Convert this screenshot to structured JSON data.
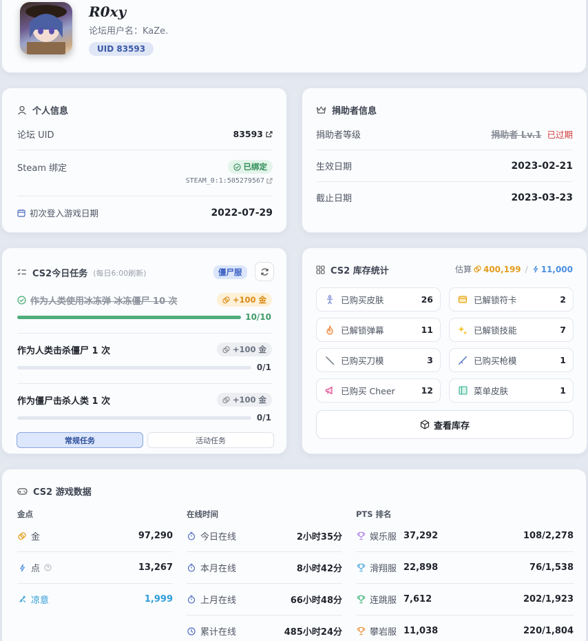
{
  "profile": {
    "name": "R0xy",
    "forum_username": "论坛用户名：KaZe.",
    "uid_badge": "UID 83593"
  },
  "personal": {
    "title": "个人信息",
    "forum_uid_label": "论坛 UID",
    "forum_uid": "83593",
    "steam_label": "Steam 绑定",
    "steam_status": "已绑定",
    "steam_id": "STEAM_0:1:505279567",
    "first_login_label": "初次登入游戏日期",
    "first_login": "2022-07-29"
  },
  "donor": {
    "title": "捐助者信息",
    "level_label": "捐助者等级",
    "level": "捐助者 Lv.1",
    "expired": "已过期",
    "start_label": "生效日期",
    "start": "2023-02-21",
    "end_label": "截止日期",
    "end": "2023-03-23"
  },
  "tasks": {
    "title": "CS2今日任务",
    "refresh_note": "(每日6:00刷新)",
    "server_badge": "僵尸服",
    "items": [
      {
        "name": "作为人类使用冰冻弹 冰冻僵尸 10 次",
        "reward": "+100 金",
        "progress": "10/10",
        "fraction": 1.0,
        "done": true
      },
      {
        "name": "作为人类击杀僵尸 1 次",
        "reward": "+100 金",
        "progress": "0/1",
        "fraction": 0.0,
        "done": false
      },
      {
        "name": "作为僵尸击杀人类 1 次",
        "reward": "+100 金",
        "progress": "0/1",
        "fraction": 0.0,
        "done": false
      }
    ],
    "tab_regular": "常规任务",
    "tab_event": "活动任务"
  },
  "inventory": {
    "title": "CS2 库存统计",
    "estimate_label": "估算",
    "estimate_gold": "400,199",
    "slash": "/",
    "estimate_points": "11,000",
    "stats": [
      {
        "label": "已购买皮肤",
        "value": "26",
        "icon": "person-icon"
      },
      {
        "label": "已解锁符卡",
        "value": "2",
        "icon": "card-icon"
      },
      {
        "label": "已解锁弹幕",
        "value": "11",
        "icon": "flame-icon"
      },
      {
        "label": "已解锁技能",
        "value": "7",
        "icon": "sparkle-icon"
      },
      {
        "label": "已购买刀模",
        "value": "3",
        "icon": "knife-icon"
      },
      {
        "label": "已购买枪模",
        "value": "1",
        "icon": "gun-icon"
      },
      {
        "label": "已购买 Cheer",
        "value": "12",
        "icon": "megaphone-icon"
      },
      {
        "label": "菜单皮肤",
        "value": "1",
        "icon": "panel-icon"
      }
    ],
    "view_button": "查看库存"
  },
  "game": {
    "title": "CS2 游戏数据",
    "currency_header": "金点",
    "currency": [
      {
        "label": "金",
        "value": "97,290"
      },
      {
        "label": "点",
        "value": "13,267"
      },
      {
        "label": "凉意",
        "value": "1,999"
      }
    ],
    "online_header": "在线时间",
    "online": [
      {
        "label": "今日在线",
        "value": "2小时35分"
      },
      {
        "label": "本月在线",
        "value": "8小时42分"
      },
      {
        "label": "上月在线",
        "value": "66小时48分"
      },
      {
        "label": "累计在线",
        "value": "485小时24分"
      }
    ],
    "pts_header": "PTS 排名",
    "pts": [
      {
        "label": "娱乐服",
        "points": "37,292",
        "rank": "108/2,278",
        "color": "#b084e6"
      },
      {
        "label": "滑翔服",
        "points": "22,898",
        "rank": "76/1,538",
        "color": "#4aa8e0"
      },
      {
        "label": "连跳服",
        "points": "7,612",
        "rank": "202/1,923",
        "color": "#3fb67a"
      },
      {
        "label": "攀岩服",
        "points": "11,038",
        "rank": "220/1,804",
        "color": "#e8953c"
      }
    ]
  }
}
